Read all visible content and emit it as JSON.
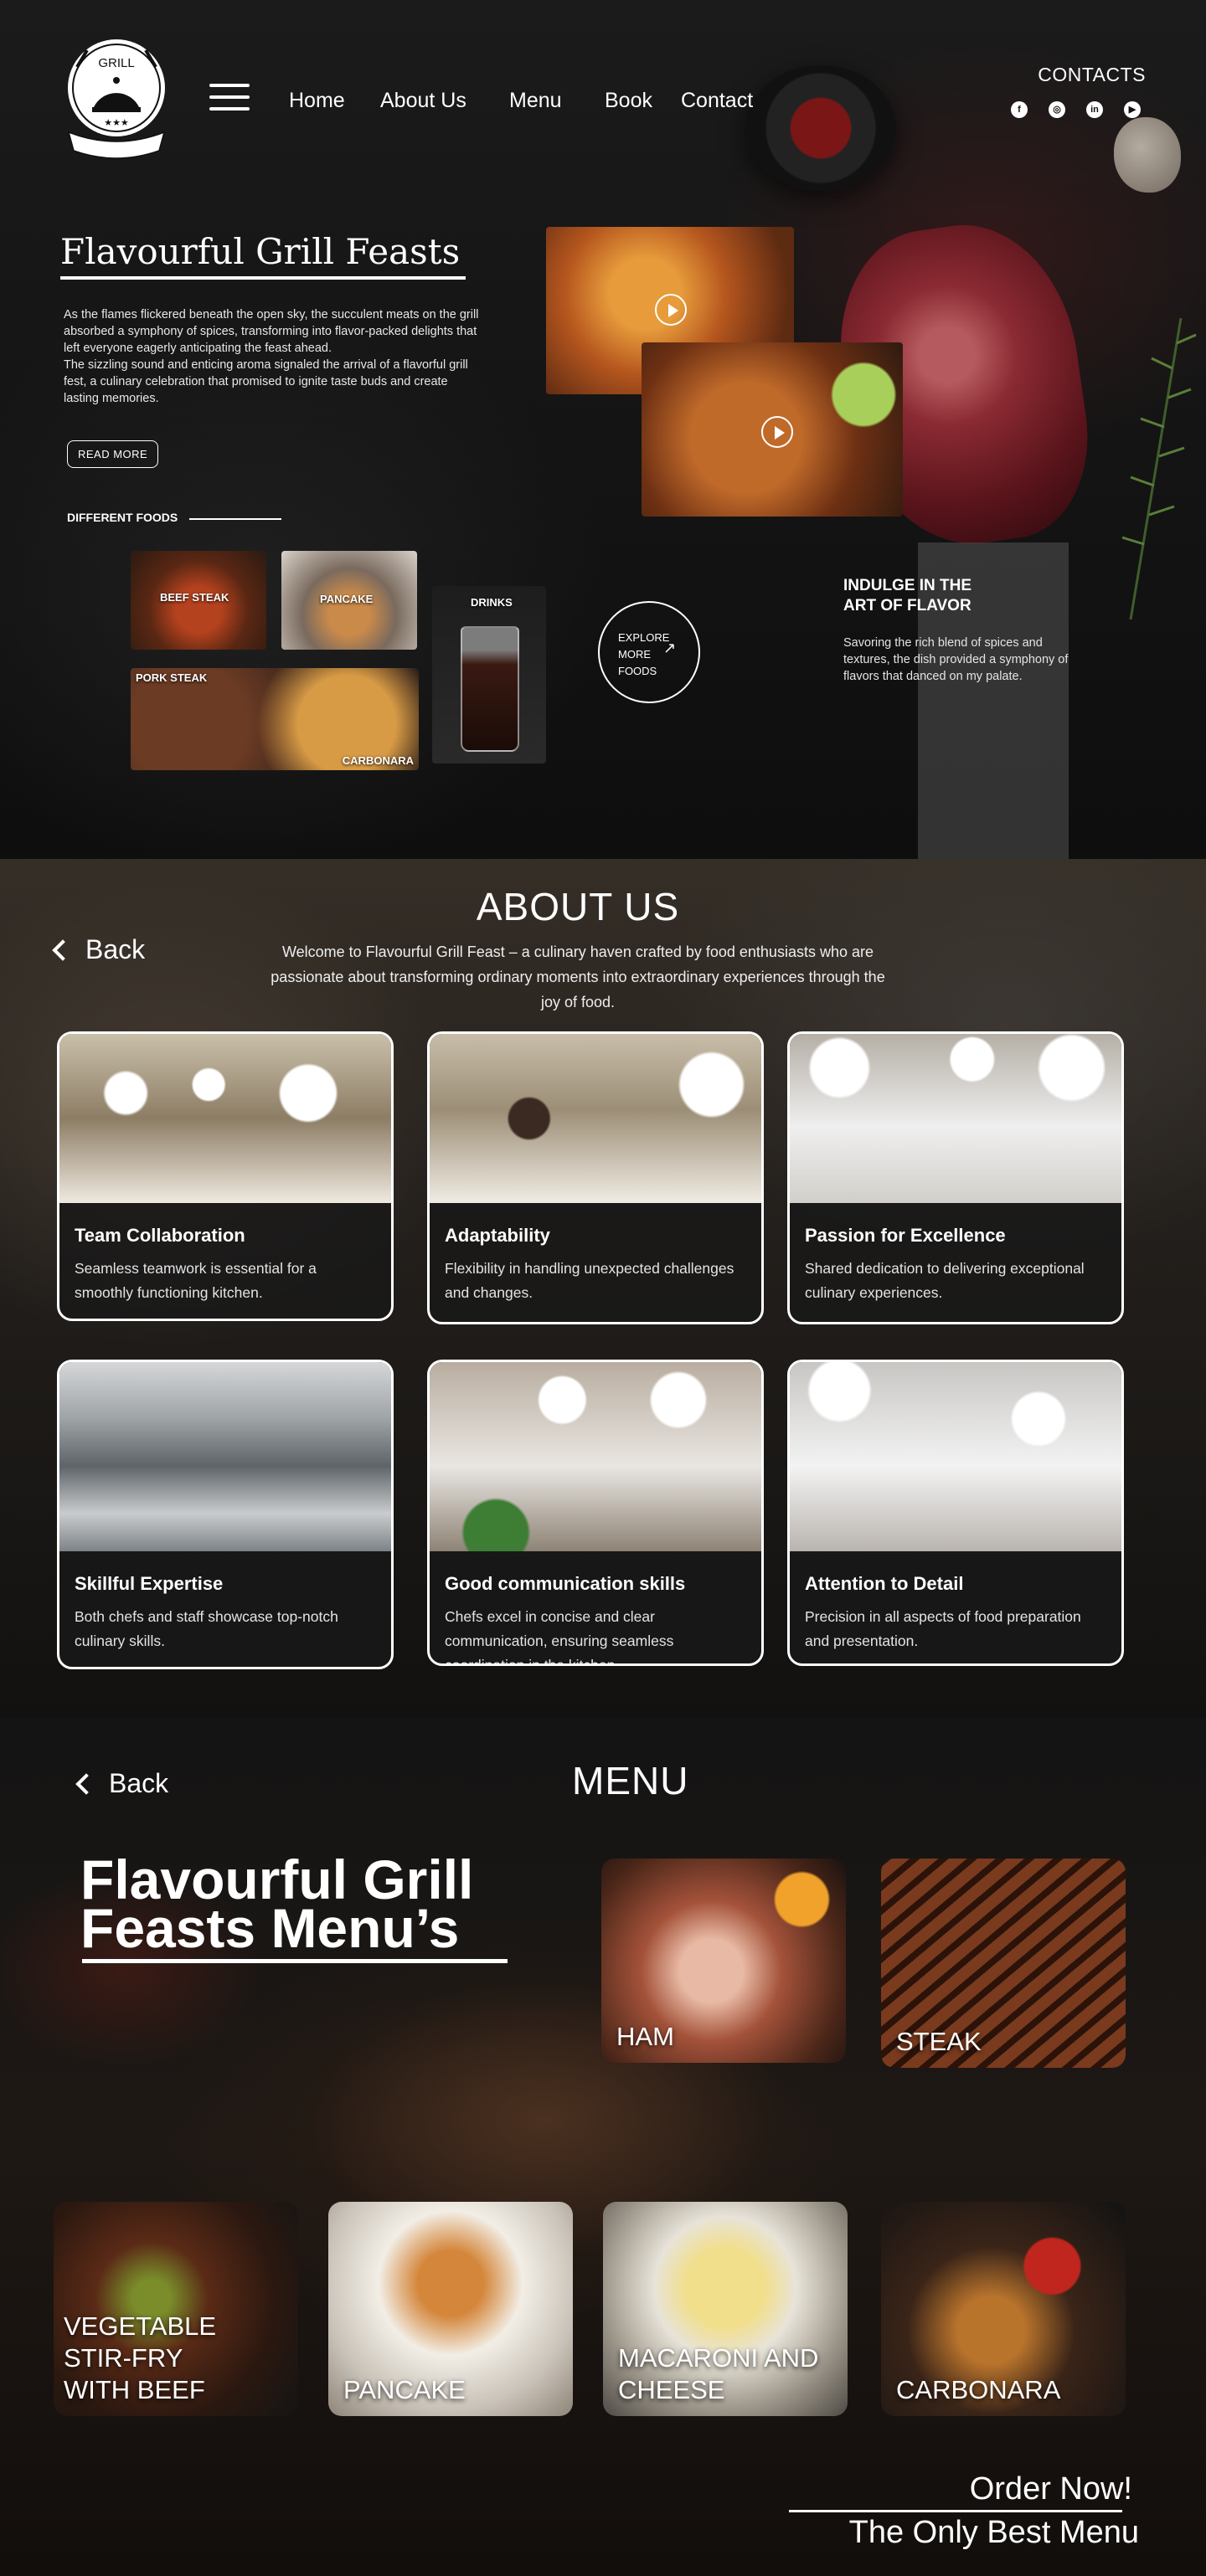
{
  "header": {
    "logo_text": "GRILL",
    "nav": [
      "Home",
      "About Us",
      "Menu",
      "Book",
      "Contact"
    ],
    "contacts_title": "CONTACTS",
    "social_icons": [
      "facebook-icon",
      "instagram-icon",
      "linkedin-icon",
      "youtube-icon"
    ]
  },
  "hero": {
    "title": "Flavourful Grill Feasts",
    "paragraph_1": "As the flames flickered beneath the open sky, the succulent meats on the grill absorbed a symphony of spices, transforming into flavor-packed delights that left everyone eagerly anticipating the feast ahead.",
    "paragraph_2": "The sizzling sound and enticing aroma signaled the arrival of a flavorful grill fest, a culinary celebration that promised to ignite taste buds and create lasting memories.",
    "read_more": "READ MORE",
    "different_foods": "DIFFERENT FOODS",
    "foods": {
      "beef_steak": "BEEF STEAK",
      "pancake": "PANCAKE",
      "pork_steak": "PORK STEAK",
      "carbonara": "CARBONARA",
      "drinks": "DRINKS"
    },
    "explore_lines": [
      "EXPLORE",
      "MORE",
      "FOODS"
    ],
    "indulge_title_lines": [
      "INDULGE IN THE",
      "ART OF FLAVOR"
    ],
    "indulge_text": "Savoring the rich blend of spices and textures, the dish provided a symphony of flavors that danced on my palate."
  },
  "about": {
    "back": "Back",
    "title": "ABOUT US",
    "intro": "Welcome to Flavourful Grill Feast – a culinary haven crafted by food enthusiasts who are passionate about transforming ordinary moments into extraordinary experiences through the joy of food.",
    "cards": [
      {
        "title": "Team Collaboration",
        "text": "Seamless teamwork is essential for a smoothly functioning kitchen."
      },
      {
        "title": "Adaptability",
        "text": "Flexibility in handling unexpected challenges and changes."
      },
      {
        "title": "Passion for Excellence",
        "text": "Shared dedication to delivering exceptional culinary experiences."
      },
      {
        "title": "Skillful Expertise",
        "text": "Both chefs and staff showcase top-notch culinary skills."
      },
      {
        "title": "Good communication skills",
        "text": "Chefs excel in concise and clear communication, ensuring seamless coordination in the kitchen."
      },
      {
        "title": "Attention to Detail",
        "text": "Precision in all aspects of food preparation and presentation."
      }
    ]
  },
  "menu": {
    "back": "Back",
    "title": "MENU",
    "headline_lines": [
      "Flavourful Grill",
      "Feasts Menu’s"
    ],
    "dishes": {
      "ham": "HAM",
      "steak": "STEAK",
      "vegetable": [
        "VEGETABLE",
        "STIR-FRY",
        "WITH BEEF"
      ],
      "pancake": "PANCAKE",
      "macaroni": [
        "MACARONI AND",
        "CHEESE"
      ],
      "carbonara": "CARBONARA"
    },
    "order_now": "Order Now!",
    "tagline": "The Only Best Menu"
  }
}
